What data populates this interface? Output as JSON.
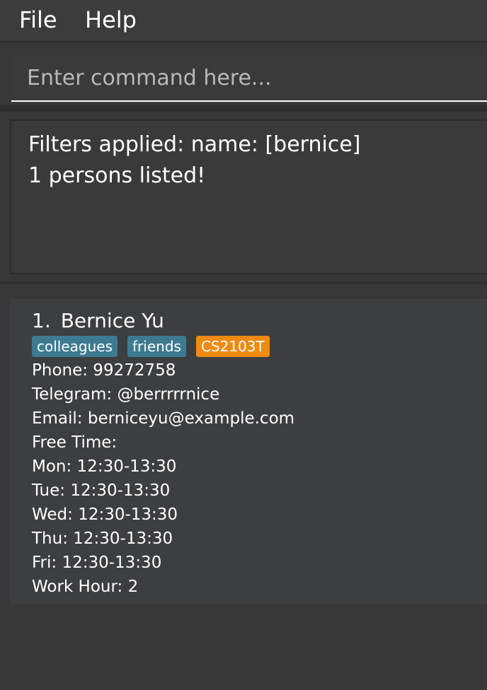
{
  "menu": {
    "file_label": "File",
    "help_label": "Help"
  },
  "command": {
    "value": "",
    "placeholder": "Enter command here..."
  },
  "result": {
    "lines": [
      "Filters applied: name: [bernice]",
      "1 persons listed!"
    ]
  },
  "persons": [
    {
      "index": "1.",
      "name": "Bernice Yu",
      "tags": [
        "colleagues",
        "friends"
      ],
      "module_tag": "CS2103T",
      "phone": "Phone: 99272758",
      "telegram": "Telegram: @berrrrrnice",
      "email": "Email: berniceyu@example.com",
      "free_time_label": "Free Time:",
      "free_time": [
        "Mon: 12:30-13:30",
        "Tue: 12:30-13:30",
        "Wed: 12:30-13:30",
        "Thu: 12:30-13:30",
        "Fri: 12:30-13:30"
      ],
      "work_hour": "Work Hour: 2"
    }
  ],
  "colors": {
    "background": "#383838",
    "card": "#3d3e40",
    "tag_blue": "#3e7b91",
    "tag_orange": "#f08a10",
    "text": "#ffffff"
  }
}
